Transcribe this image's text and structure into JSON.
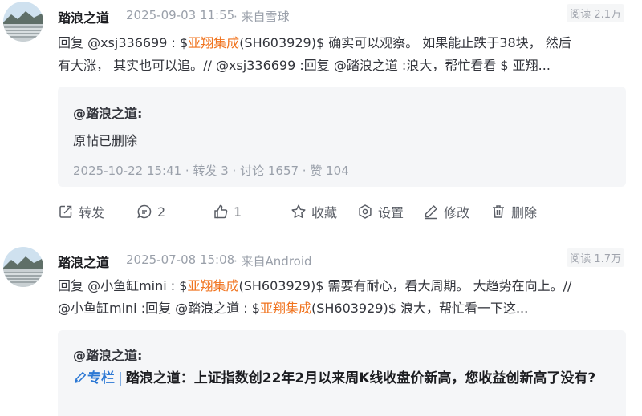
{
  "post1": {
    "author": "踏浪之道",
    "meta_time": "2025-09-03 11:55",
    "meta_source": "· 来自雪球",
    "reads": "阅读 2.1万",
    "body_prefix": "回复 @xsj336699 : $",
    "body_stock": "亚翔集成",
    "body_rest_line1": "(SH603929)$ 确实可以观察。 如果能止跌于38块， 然后",
    "body_line2": "有大涨， 其实也可以追。// @xsj336699 :回复 @踏浪之道 :浪大，帮忙看看 $ 亚翔...",
    "quote": {
      "author": "@踏浪之道:",
      "text": "原帖已删除",
      "meta": "2025-10-22 15:41 · 转发 3 · 讨论 1657 · 赞 104"
    },
    "actions": {
      "repost": "转发",
      "comment_count": "2",
      "like_count": "1",
      "favorite": "收藏",
      "settings": "设置",
      "edit": "修改",
      "delete": "删除"
    }
  },
  "post2": {
    "author": "踏浪之道",
    "meta_time": "2025-07-08 15:08",
    "meta_source": "· 来自Android",
    "reads": "阅读 1.7万",
    "body_line1_prefix": "回复 @小鱼缸mini : $",
    "body_stock": "亚翔集成",
    "body_line1_rest": "(SH603929)$ 需要有耐心，看大周期。 大趋势在向上。//",
    "body_line2_prefix": "@小鱼缸mini :回复 @踏浪之道 : $",
    "body_line2_stock": "亚翔集成",
    "body_line2_rest": "(SH603929)$ 浪大，帮忙看一下这...",
    "quote": {
      "author": "@踏浪之道:",
      "column_tag": "专栏",
      "column_bar": "|",
      "column_title": "踏浪之道：上证指数创22年2月以来周K线收盘价新高，您收益创新高了没有?"
    }
  },
  "colors": {
    "stock_link": "#f0731e",
    "column_link": "#2c78d4",
    "meta_gray": "#9aa0aa"
  },
  "icons": [
    "avatar-landscape",
    "repost-icon",
    "comment-icon",
    "like-icon",
    "star-icon",
    "settings-icon",
    "edit-icon",
    "delete-icon",
    "column-pen-icon"
  ]
}
